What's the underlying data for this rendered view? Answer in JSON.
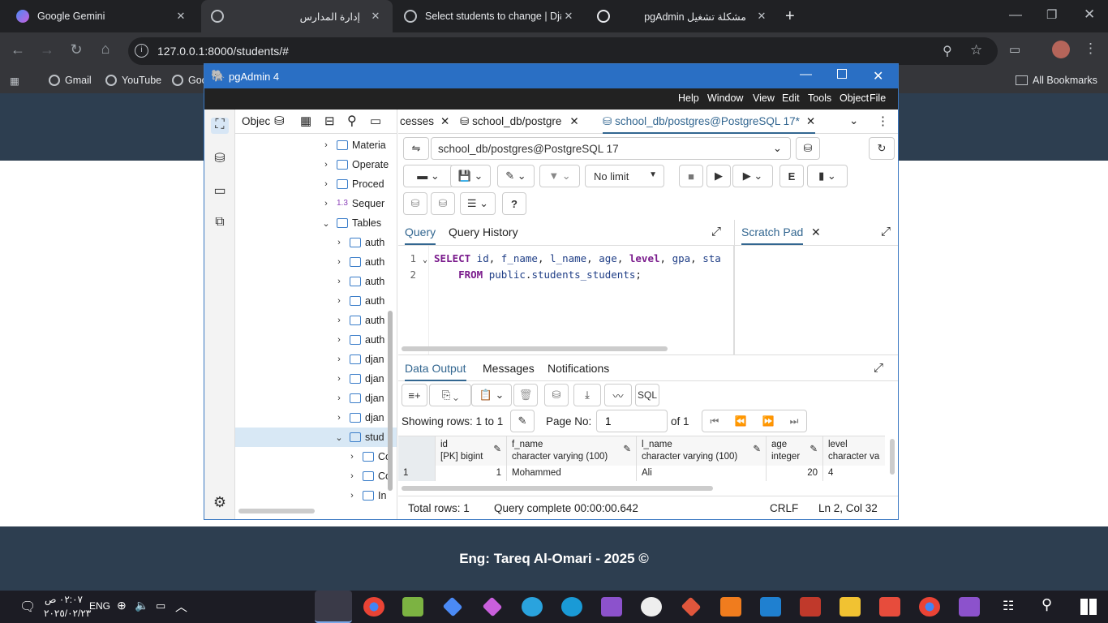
{
  "browser": {
    "tabs": [
      {
        "title": "Google Gemini",
        "icon": "gemini-icon"
      },
      {
        "title": "إدارة المدارس",
        "icon": "globe-icon"
      },
      {
        "title": "Select students to change | Djan",
        "icon": "globe-icon"
      },
      {
        "title": "pgAdmin مشكلة تشغيل",
        "icon": "openai-icon"
      }
    ],
    "new_tab": "+",
    "url": "127.0.0.1:8000/students/#",
    "bookmarks": [
      "Gmail",
      "YouTube",
      "Goo"
    ],
    "all_bookmarks": "All Bookmarks"
  },
  "pgadmin": {
    "title": "pgAdmin 4",
    "menu": [
      "File",
      "Object",
      "Tools",
      "Edit",
      "View",
      "Window",
      "Help"
    ],
    "object_explorer_label": "Objec",
    "tree": [
      {
        "label": "Materia",
        "indent": 1
      },
      {
        "label": "Operate",
        "indent": 1
      },
      {
        "label": "Proced",
        "indent": 1
      },
      {
        "label": "Sequer",
        "indent": 1
      },
      {
        "label": "Tables",
        "indent": 1
      },
      {
        "label": "auth",
        "indent": 2
      },
      {
        "label": "auth",
        "indent": 2
      },
      {
        "label": "auth",
        "indent": 2
      },
      {
        "label": "auth",
        "indent": 2
      },
      {
        "label": "auth",
        "indent": 2
      },
      {
        "label": "auth",
        "indent": 2
      },
      {
        "label": "djan",
        "indent": 2
      },
      {
        "label": "djan",
        "indent": 2
      },
      {
        "label": "djan",
        "indent": 2
      },
      {
        "label": "djan",
        "indent": 2
      },
      {
        "label": "stud",
        "indent": 2
      },
      {
        "label": "Co",
        "indent": 3
      },
      {
        "label": "Co",
        "indent": 3
      },
      {
        "label": "In",
        "indent": 3
      }
    ],
    "sequence_prefix": "1.3",
    "tabs": [
      {
        "label": "cesses"
      },
      {
        "label": "school_db/postgre"
      },
      {
        "label": "school_db/postgres@PostgreSQL 17*"
      }
    ],
    "connection": "school_db/postgres@PostgreSQL 17",
    "limit": "No limit",
    "query_tabs": [
      "Query",
      "Query History"
    ],
    "scratch_pad": "Scratch Pad",
    "code_lines": [
      {
        "num": "1",
        "parts": [
          [
            "kw",
            "SELECT"
          ],
          [
            "id",
            " id"
          ],
          [
            "p",
            ", "
          ],
          [
            "id",
            "f_name"
          ],
          [
            "p",
            ", "
          ],
          [
            "id",
            "l_name"
          ],
          [
            "p",
            ", "
          ],
          [
            "id",
            "age"
          ],
          [
            "p",
            ", "
          ],
          [
            "kw",
            "level"
          ],
          [
            "p",
            ", "
          ],
          [
            "id",
            "gpa"
          ],
          [
            "p",
            ", "
          ],
          [
            "id",
            "sta"
          ]
        ]
      },
      {
        "num": "2",
        "parts": [
          [
            "p",
            "    "
          ],
          [
            "kw",
            "FROM"
          ],
          [
            "id",
            " public"
          ],
          [
            "p",
            "."
          ],
          [
            "id",
            "students_students"
          ],
          [
            "p",
            ";"
          ]
        ]
      }
    ],
    "output_tabs": [
      "Data Output",
      "Messages",
      "Notifications"
    ],
    "sql_btn": "SQL",
    "showing_rows": "Showing rows: 1 to 1",
    "page_no_label": "Page No:",
    "page_no": "1",
    "of_pages": "of 1",
    "columns": [
      {
        "name": "id",
        "type": "[PK] bigint"
      },
      {
        "name": "f_name",
        "type": "character varying (100)"
      },
      {
        "name": "l_name",
        "type": "character varying (100)"
      },
      {
        "name": "age",
        "type": "integer"
      },
      {
        "name": "level",
        "type": "character va"
      }
    ],
    "rows": [
      {
        "num": "1",
        "cells": [
          "1",
          "Mohammed",
          "Ali",
          "20",
          "4"
        ]
      }
    ],
    "status": {
      "total_rows": "Total rows: 1",
      "query_complete": "Query complete 00:00:00.642",
      "eol": "CRLF",
      "position": "Ln 2, Col 32"
    }
  },
  "page": {
    "footer": "Eng: Tareq Al-Omari - 2025 ©"
  },
  "taskbar": {
    "time": "٠٢:٠٧ ص",
    "date": "٢٠٢٥/٠٢/٢٣",
    "lang": "ENG"
  },
  "colors": {
    "page_header": "#2d3e50",
    "pgadmin_title": "#2a6fc4",
    "accent": "#326690"
  }
}
